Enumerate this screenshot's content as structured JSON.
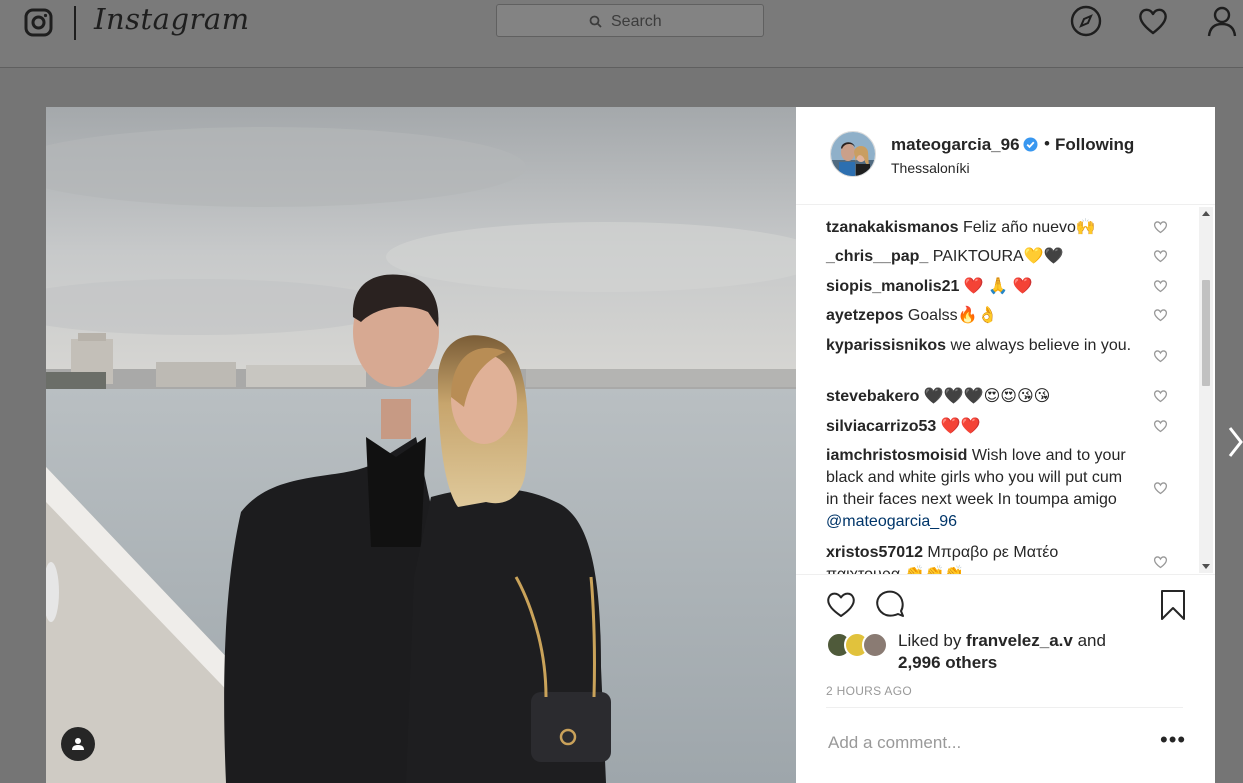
{
  "nav": {
    "logo_text": "Instagram",
    "search_placeholder": "Search",
    "icons": [
      "instagram-camera-icon",
      "search-icon",
      "explore-compass-icon",
      "activity-heart-icon",
      "profile-icon"
    ]
  },
  "post": {
    "username": "mateogarcia_96",
    "verified": true,
    "separator": "•",
    "follow_status": "Following",
    "location": "Thessaloníki",
    "likes_prefix": "Liked by ",
    "liked_by_user": "franvelez_a.v",
    "likes_and": " and",
    "likes_others": "2,996 others",
    "timestamp": "2 HOURS AGO",
    "add_comment_placeholder": "Add a comment...",
    "more_label": "•••"
  },
  "comments": [
    {
      "user": "tzanakakismanos",
      "text": "Feliz año nuevo🙌"
    },
    {
      "user": "_chris__pap_",
      "text": "PAIKTOURA💛🖤"
    },
    {
      "user": "siopis_manolis21",
      "text": "❤️ 🙏 ❤️"
    },
    {
      "user": "ayetzepos",
      "text": "Goalss🔥👌"
    },
    {
      "user": "kyparissisnikos",
      "text": "we always believe in you."
    },
    {
      "user": "stevebakero",
      "text": "🖤🖤🖤😍😍😘😘"
    },
    {
      "user": "silviacarrizo53",
      "text": "❤️❤️"
    },
    {
      "user": "iamchristosmoisid",
      "text": "Wish love and to your black and white girls who you will put cum in their faces next week In toumpa amigo",
      "mention": "@mateogarcia_96"
    },
    {
      "user": "xristos57012",
      "text": "Μπραβο ρε Ματέο παιχτουρα 👏👏👏"
    }
  ],
  "colors": {
    "verified_blue": "#3897f0",
    "text": "#262626",
    "muted": "#999999",
    "mention": "#003569",
    "overlay": "#757575"
  }
}
